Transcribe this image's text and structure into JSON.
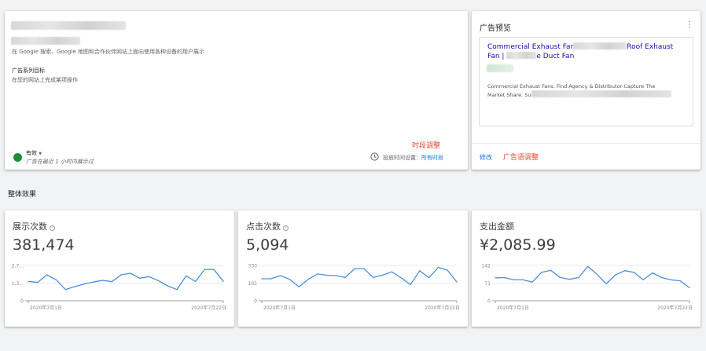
{
  "campaign": {
    "networks_desc": "在 Google 搜索、Google 地图和合作伙伴网站上面向使用各种设备的用户展示",
    "goal_label": "广告系列目标",
    "goal_value": "在您的网站上完成某项操作",
    "status_label": "有效",
    "status_note": "广告在最近 1 小时内展示过",
    "annotation_schedule": "时段调整",
    "schedule_label": "投放时间设置：",
    "schedule_value": "所有时段"
  },
  "preview": {
    "title": "广告预览",
    "headline_1": "Commercial Exhaust Far",
    "headline_2": "Roof Exhaust",
    "headline_3": "Fan | ",
    "headline_4": "e Duct Fan",
    "description_1": "Commercial Exhaust Fans. Find Agency & Distributor Capture The",
    "description_2": "Market Share. Su",
    "edit_link": "修改",
    "annotation_ad": "广告语调整"
  },
  "section_title": "整体效果",
  "metrics": [
    {
      "title": "展示次数",
      "value": "381,474",
      "color": "#4a90d9",
      "y_ticks": [
        "2.7...",
        "1.3...",
        "0"
      ],
      "x_start": "2020年7月1日",
      "x_end": "2020年7月22日"
    },
    {
      "title": "点击次数",
      "value": "5,094",
      "color": "#4a90d9",
      "y_ticks": [
        "330",
        "165",
        "0"
      ],
      "x_start": "2020年7月1日",
      "x_end": "2020年7月22日"
    },
    {
      "title": "支出金额",
      "value": "¥2,085.99",
      "color": "#4a90d9",
      "y_ticks": [
        "142",
        "71",
        "0"
      ],
      "x_start": "2020年7月1日",
      "x_end": "2020年7月22日"
    }
  ],
  "chart_data": [
    {
      "type": "line",
      "title": "展示次数",
      "x": [
        "2020-07-01",
        "2020-07-02",
        "2020-07-03",
        "2020-07-04",
        "2020-07-05",
        "2020-07-06",
        "2020-07-07",
        "2020-07-08",
        "2020-07-09",
        "2020-07-10",
        "2020-07-11",
        "2020-07-12",
        "2020-07-13",
        "2020-07-14",
        "2020-07-15",
        "2020-07-16",
        "2020-07-17",
        "2020-07-18",
        "2020-07-19",
        "2020-07-20",
        "2020-07-21",
        "2020-07-22"
      ],
      "values": [
        14800,
        14000,
        19800,
        16000,
        8600,
        10800,
        12800,
        14300,
        15600,
        14600,
        19800,
        21000,
        17200,
        18400,
        15400,
        11400,
        8600,
        19000,
        14700,
        24000,
        23800,
        14800
      ],
      "ylim": [
        0,
        27000
      ]
    },
    {
      "type": "line",
      "title": "点击次数",
      "x": [
        "2020-07-01",
        "2020-07-02",
        "2020-07-03",
        "2020-07-04",
        "2020-07-05",
        "2020-07-06",
        "2020-07-07",
        "2020-07-08",
        "2020-07-09",
        "2020-07-10",
        "2020-07-11",
        "2020-07-12",
        "2020-07-13",
        "2020-07-14",
        "2020-07-15",
        "2020-07-16",
        "2020-07-17",
        "2020-07-18",
        "2020-07-19",
        "2020-07-20",
        "2020-07-21",
        "2020-07-22"
      ],
      "values": [
        205,
        205,
        235,
        200,
        130,
        200,
        250,
        238,
        235,
        218,
        300,
        300,
        218,
        238,
        270,
        215,
        150,
        280,
        215,
        312,
        285,
        175
      ],
      "ylim": [
        0,
        330
      ]
    },
    {
      "type": "line",
      "title": "支出金额",
      "x": [
        "2020-07-01",
        "2020-07-02",
        "2020-07-03",
        "2020-07-04",
        "2020-07-05",
        "2020-07-06",
        "2020-07-07",
        "2020-07-08",
        "2020-07-09",
        "2020-07-10",
        "2020-07-11",
        "2020-07-12",
        "2020-07-13",
        "2020-07-14",
        "2020-07-15",
        "2020-07-16",
        "2020-07-17",
        "2020-07-18",
        "2020-07-19",
        "2020-07-20",
        "2020-07-21",
        "2020-07-22"
      ],
      "values": [
        92,
        93,
        84,
        84,
        75,
        114,
        122,
        94,
        86,
        93,
        138,
        106,
        68,
        104,
        121,
        114,
        84,
        112,
        93,
        84,
        80,
        52
      ],
      "ylim": [
        0,
        142
      ]
    }
  ]
}
